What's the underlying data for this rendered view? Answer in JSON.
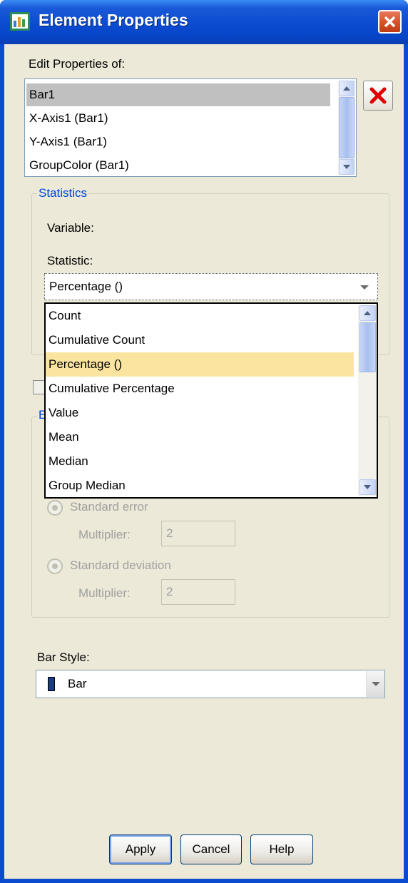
{
  "window": {
    "title": "Element Properties"
  },
  "edit_properties": {
    "label": "Edit Properties of:",
    "items": [
      "Bar1",
      "X-Axis1 (Bar1)",
      "Y-Axis1 (Bar1)",
      "GroupColor (Bar1)"
    ],
    "selected": "Bar1"
  },
  "statistics": {
    "legend": "Statistics",
    "variable_label": "Variable:",
    "statistic_label": "Statistic:",
    "selected": "Percentage ()",
    "options": [
      "Count",
      "Cumulative Count",
      "Percentage ()",
      "Cumulative Percentage",
      "Value",
      "Mean",
      "Median",
      "Group Median"
    ]
  },
  "error_bars": {
    "legend_fragment": "E",
    "standard_error_label": "Standard error",
    "standard_error_multiplier_label": "Multiplier:",
    "standard_error_multiplier": "2",
    "standard_deviation_label": "Standard deviation",
    "standard_deviation_multiplier_label": "Multiplier:",
    "standard_deviation_multiplier": "2"
  },
  "bar_style": {
    "label": "Bar Style:",
    "value": "Bar"
  },
  "buttons": {
    "apply": "Apply",
    "cancel": "Cancel",
    "help": "Help"
  },
  "colors": {
    "title_bar": "#0a4bd0",
    "dialog_face": "#ece9d8",
    "group_legend": "#0046d5",
    "dropdown_highlight": "#fae4a0",
    "list_selection": "#c0c0c0"
  }
}
